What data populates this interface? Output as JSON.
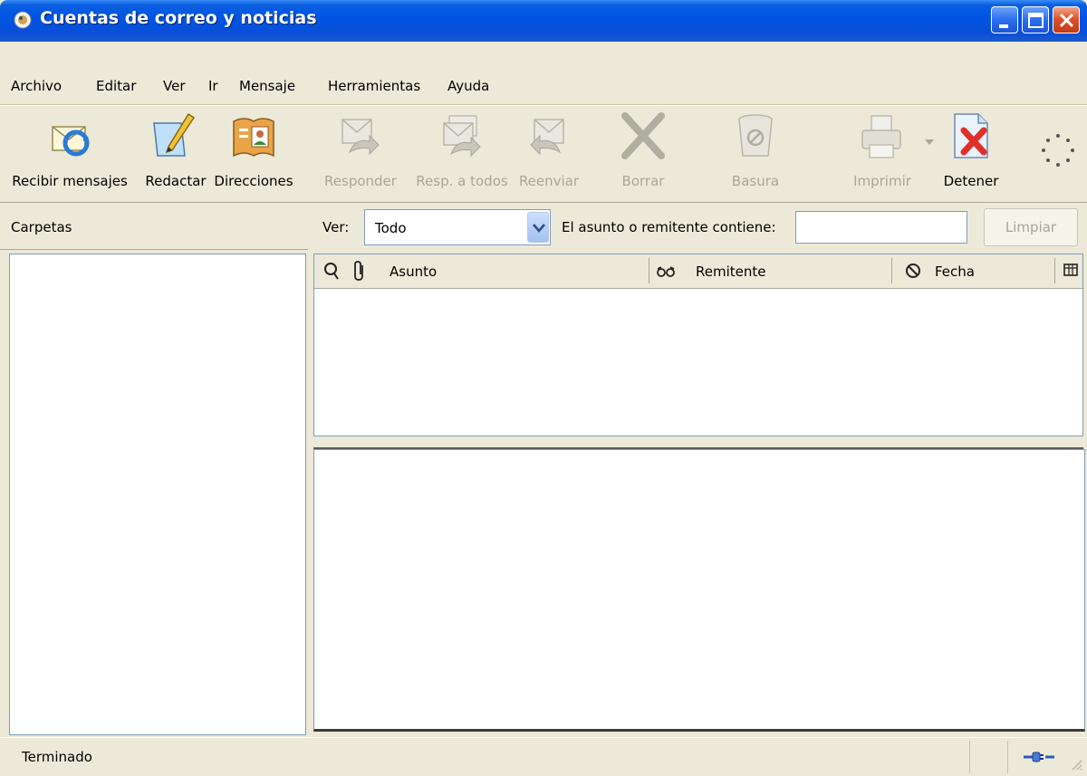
{
  "window": {
    "title": "Cuentas de correo y noticias"
  },
  "menu": {
    "items": [
      {
        "label": "Archivo"
      },
      {
        "label": "Editar"
      },
      {
        "label": "Ver"
      },
      {
        "label": "Ir"
      },
      {
        "label": "Mensaje"
      },
      {
        "label": "Herramientas"
      },
      {
        "label": "Ayuda"
      }
    ]
  },
  "toolbar": {
    "buttons": [
      {
        "label": "Recibir mensajes",
        "icon": "get-mail-icon",
        "enabled": true
      },
      {
        "label": "Redactar",
        "icon": "compose-icon",
        "enabled": true
      },
      {
        "label": "Direcciones",
        "icon": "address-book-icon",
        "enabled": true
      },
      {
        "label": "Responder",
        "icon": "reply-icon",
        "enabled": false
      },
      {
        "label": "Resp. a todos",
        "icon": "reply-all-icon",
        "enabled": false
      },
      {
        "label": "Reenviar",
        "icon": "forward-icon",
        "enabled": false
      },
      {
        "label": "Borrar",
        "icon": "delete-icon",
        "enabled": false
      },
      {
        "label": "Basura",
        "icon": "junk-icon",
        "enabled": false
      },
      {
        "label": "Imprimir",
        "icon": "print-icon",
        "enabled": false
      },
      {
        "label": "Detener",
        "icon": "stop-icon",
        "enabled": true
      }
    ]
  },
  "folders": {
    "header": "Carpetas"
  },
  "filter": {
    "view_label": "Ver:",
    "view_value": "Todo",
    "search_label": "El asunto o remitente contiene:",
    "search_value": "",
    "clear_label": "Limpiar"
  },
  "thread_columns": {
    "subject": "Asunto",
    "sender": "Remitente",
    "date": "Fecha"
  },
  "status": {
    "text": "Terminado"
  },
  "colors": {
    "titlebar": "#0054e3",
    "chrome": "#ece9d8",
    "border": "#7f9db9",
    "disabled_text": "#a8a69a"
  }
}
